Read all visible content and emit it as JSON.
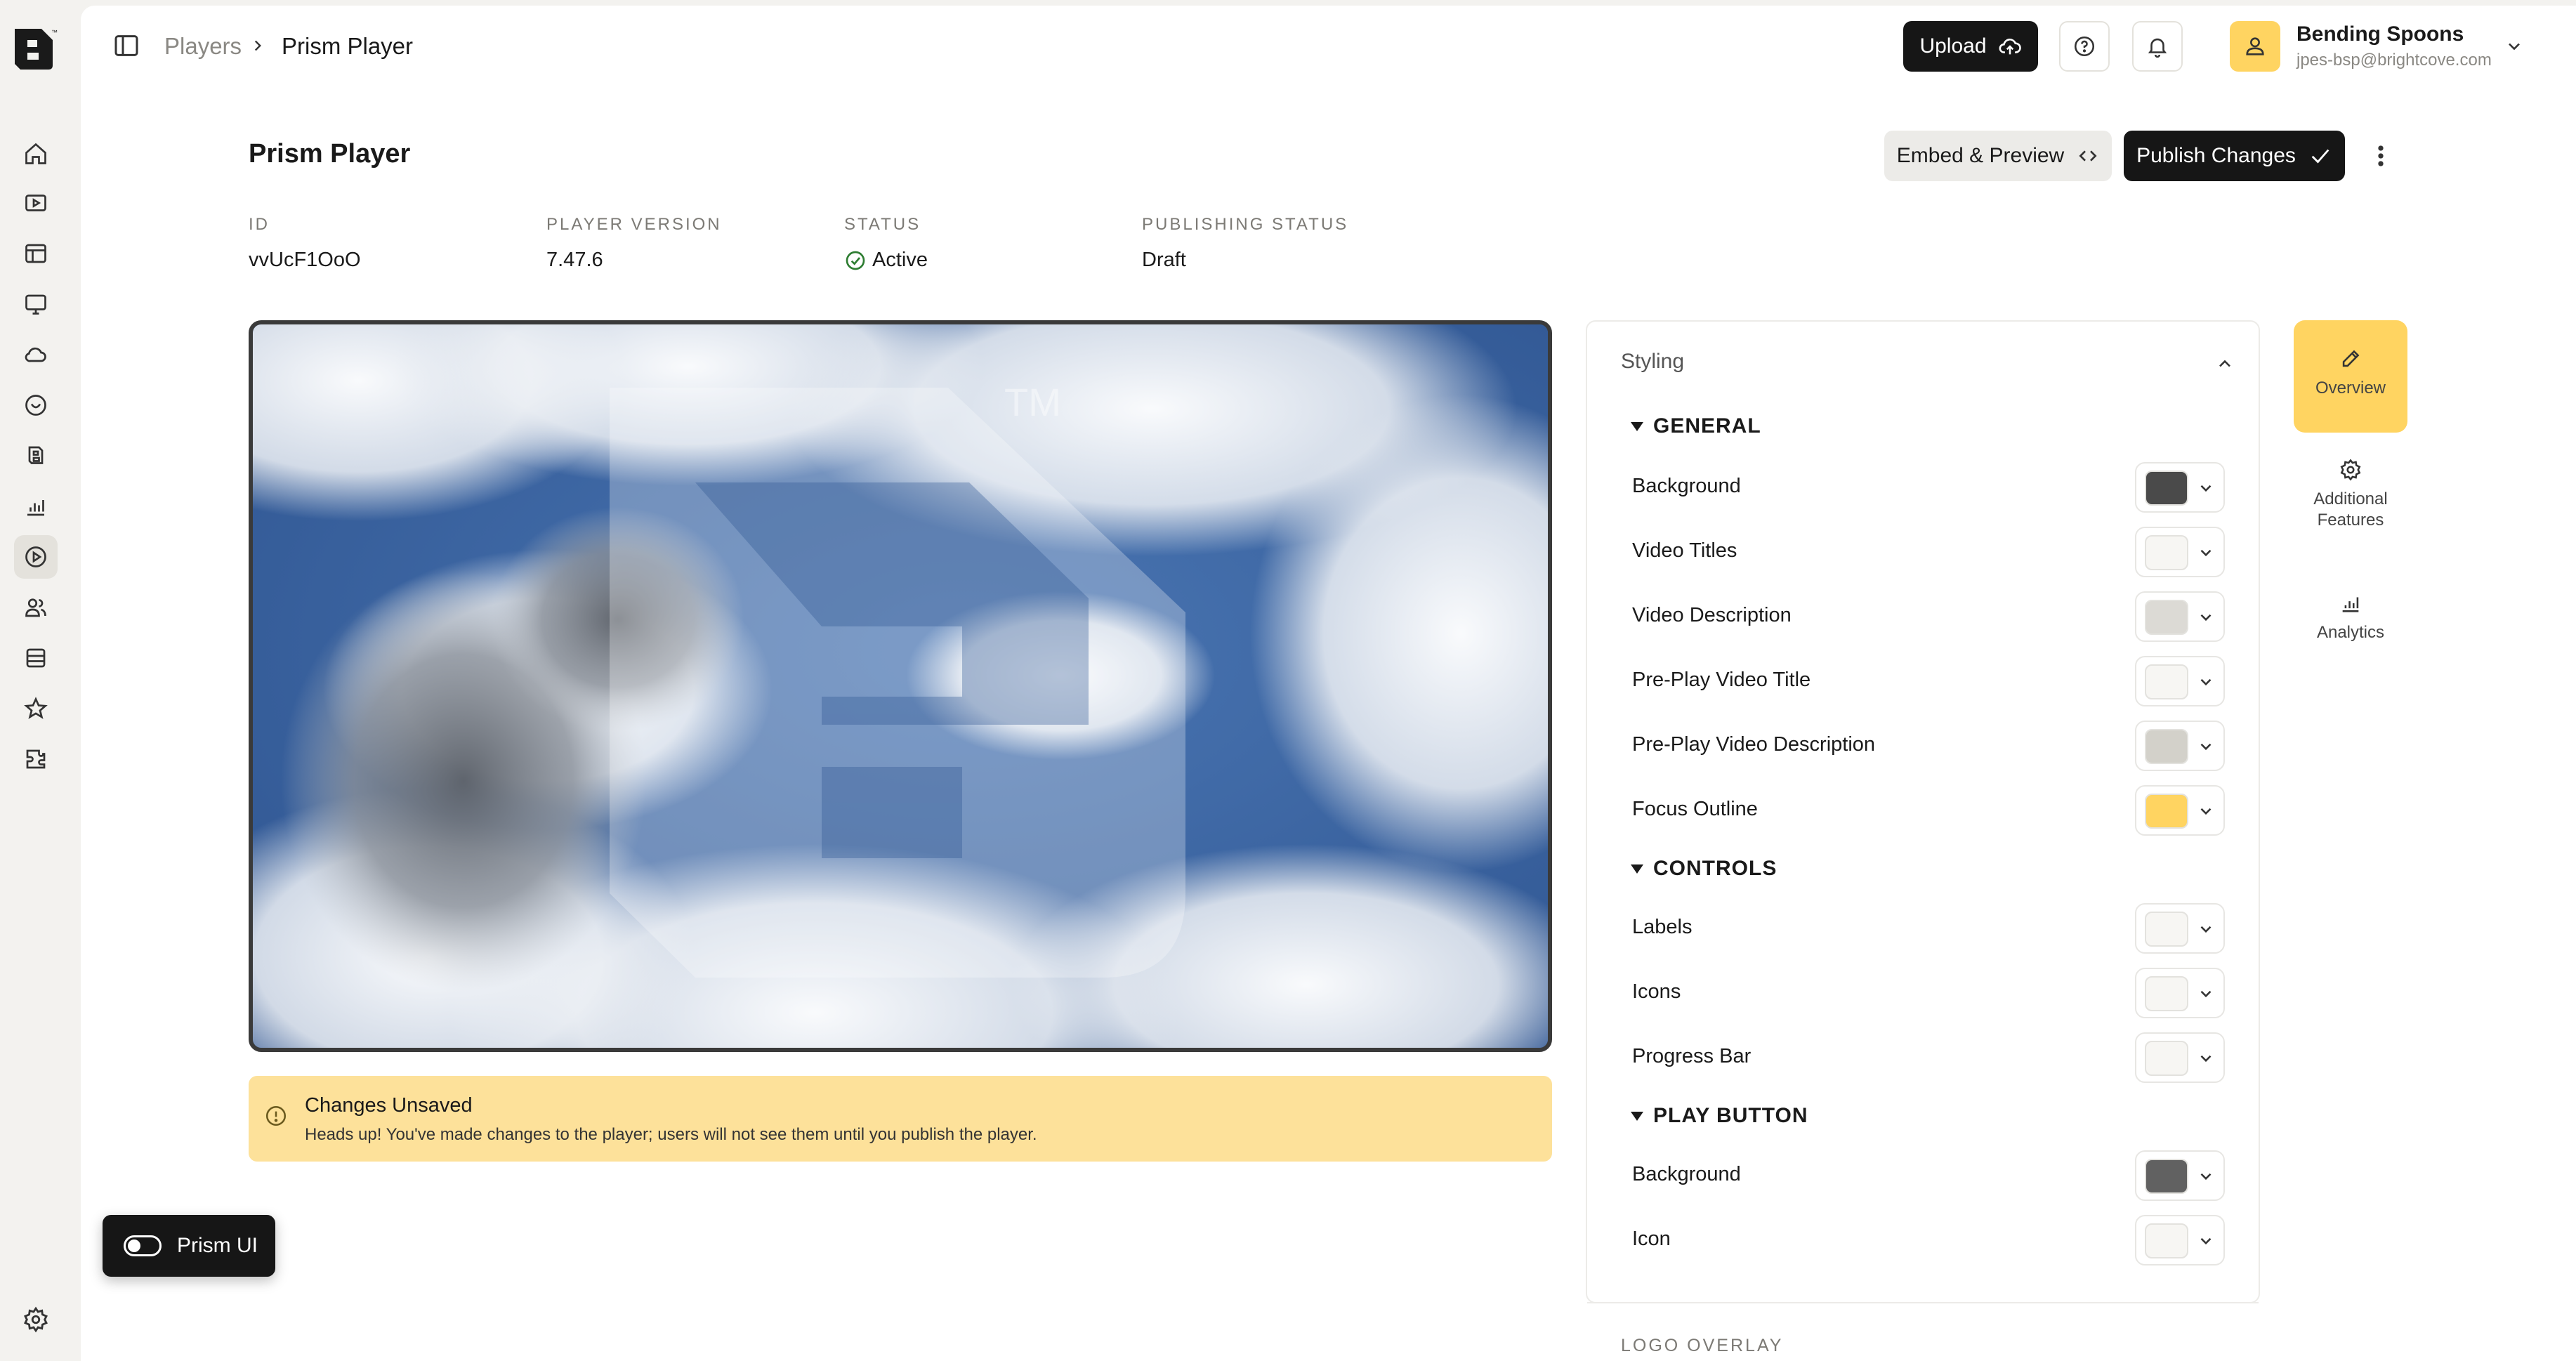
{
  "header": {
    "breadcrumbs": [
      "Players",
      "Prism Player"
    ],
    "upload_label": "Upload",
    "user": {
      "name": "Bending Spoons",
      "email": "jpes-bsp@brightcove.com"
    }
  },
  "page": {
    "title": "Prism Player",
    "embed_label": "Embed & Preview",
    "publish_label": "Publish Changes",
    "meta": [
      {
        "label": "ID",
        "value": "vvUcF1OoO"
      },
      {
        "label": "PLAYER VERSION",
        "value": "7.47.6"
      },
      {
        "label": "STATUS",
        "value": "Active"
      },
      {
        "label": "PUBLISHING STATUS",
        "value": "Draft"
      }
    ]
  },
  "alert": {
    "title": "Changes Unsaved",
    "text": "Heads up! You've made changes to the player; users will not see them until you publish the player."
  },
  "toggle": {
    "label": "Prism UI",
    "on": true
  },
  "styling": {
    "title": "Styling",
    "sections": [
      {
        "title": "GENERAL",
        "rows": [
          {
            "label": "Background",
            "color": "#4a4a4a"
          },
          {
            "label": "Video Titles",
            "color": "#f7f6f3"
          },
          {
            "label": "Video Description",
            "color": "#dcdad5"
          },
          {
            "label": "Pre-Play Video Title",
            "color": "#f7f6f3"
          },
          {
            "label": "Pre-Play Video Description",
            "color": "#d3d1ca"
          },
          {
            "label": "Focus Outline",
            "color": "#ffd461"
          }
        ]
      },
      {
        "title": "CONTROLS",
        "rows": [
          {
            "label": "Labels",
            "color": "#f7f6f3"
          },
          {
            "label": "Icons",
            "color": "#f7f6f3"
          },
          {
            "label": "Progress Bar",
            "color": "#f7f6f3"
          }
        ]
      },
      {
        "title": "PLAY BUTTON",
        "rows": [
          {
            "label": "Background",
            "color": "#616161"
          },
          {
            "label": "Icon",
            "color": "#f7f6f3"
          }
        ]
      }
    ],
    "next_section": "LOGO OVERLAY"
  },
  "side_tabs": [
    {
      "label": "Overview",
      "icon": "pencil-icon",
      "active": true
    },
    {
      "label": "Additional Features",
      "icon": "gear-icon",
      "active": false
    },
    {
      "label": "Analytics",
      "icon": "bar-chart-icon",
      "active": false
    }
  ],
  "colors": {
    "accent": "#ffd461",
    "alert_bg": "#fde19a",
    "dark": "#161616"
  }
}
